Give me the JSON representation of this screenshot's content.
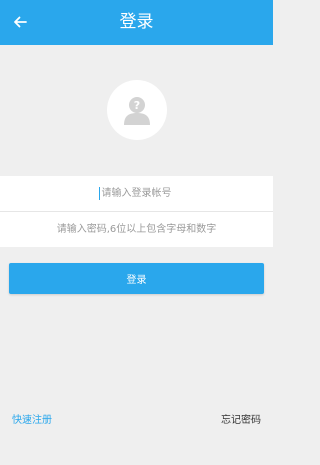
{
  "appbar": {
    "title": "登录",
    "back_icon": "arrow-left-icon"
  },
  "avatar": {
    "icon": "unknown-user-icon"
  },
  "form": {
    "account": {
      "placeholder": "请输入登录帐号",
      "value": ""
    },
    "password": {
      "placeholder": "请输入密码,6位以上包含字母和数字",
      "value": ""
    },
    "submit_label": "登录"
  },
  "footer": {
    "register_label": "快速注册",
    "forgot_label": "忘记密码"
  },
  "colors": {
    "primary": "#2aa7ec",
    "background": "#efefef",
    "field_background": "#ffffff"
  }
}
